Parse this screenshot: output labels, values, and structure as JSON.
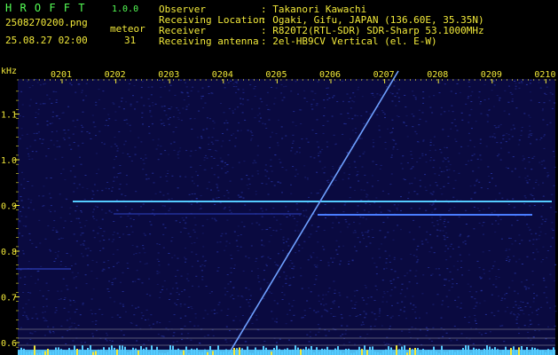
{
  "header": {
    "app_title": "H R O F F T",
    "app_version": "1.0.0",
    "filename": "2508270200.png",
    "datetime": "25.08.27 02:00",
    "count_label": "meteor",
    "count_value": "31",
    "info": [
      {
        "label": "Observer",
        "value": ": Takanori Kawachi"
      },
      {
        "label": "Receiving Location",
        "value": ": Ogaki, Gifu, JAPAN (136.60E, 35.35N)"
      },
      {
        "label": "Receiver",
        "value": ": R820T2(RTL-SDR) SDR-Sharp 53.1000MHz"
      },
      {
        "label": "Receiving antenna",
        "value": ": 2el-HB9CV Vertical (el. E-W)"
      }
    ]
  },
  "spectrogram": {
    "y_unit": "kHz",
    "y_ticks": [
      {
        "label": "1.1",
        "v": 1.1
      },
      {
        "label": "1.0",
        "v": 1.0
      },
      {
        "label": "0.9",
        "v": 0.9
      },
      {
        "label": "0.8",
        "v": 0.8
      },
      {
        "label": "0.7",
        "v": 0.7
      },
      {
        "label": "0.6",
        "v": 0.6
      }
    ],
    "x_ticks": [
      "0201",
      "0202",
      "0203",
      "0204",
      "0205",
      "0206",
      "0207",
      "0208",
      "0209",
      "0210"
    ],
    "colors": {
      "background": "#0a0a40",
      "noise": "#2a3ab0",
      "signal": "#55ccff",
      "trace": "#6ea0ff",
      "tick": "#f2e93a"
    }
  }
}
